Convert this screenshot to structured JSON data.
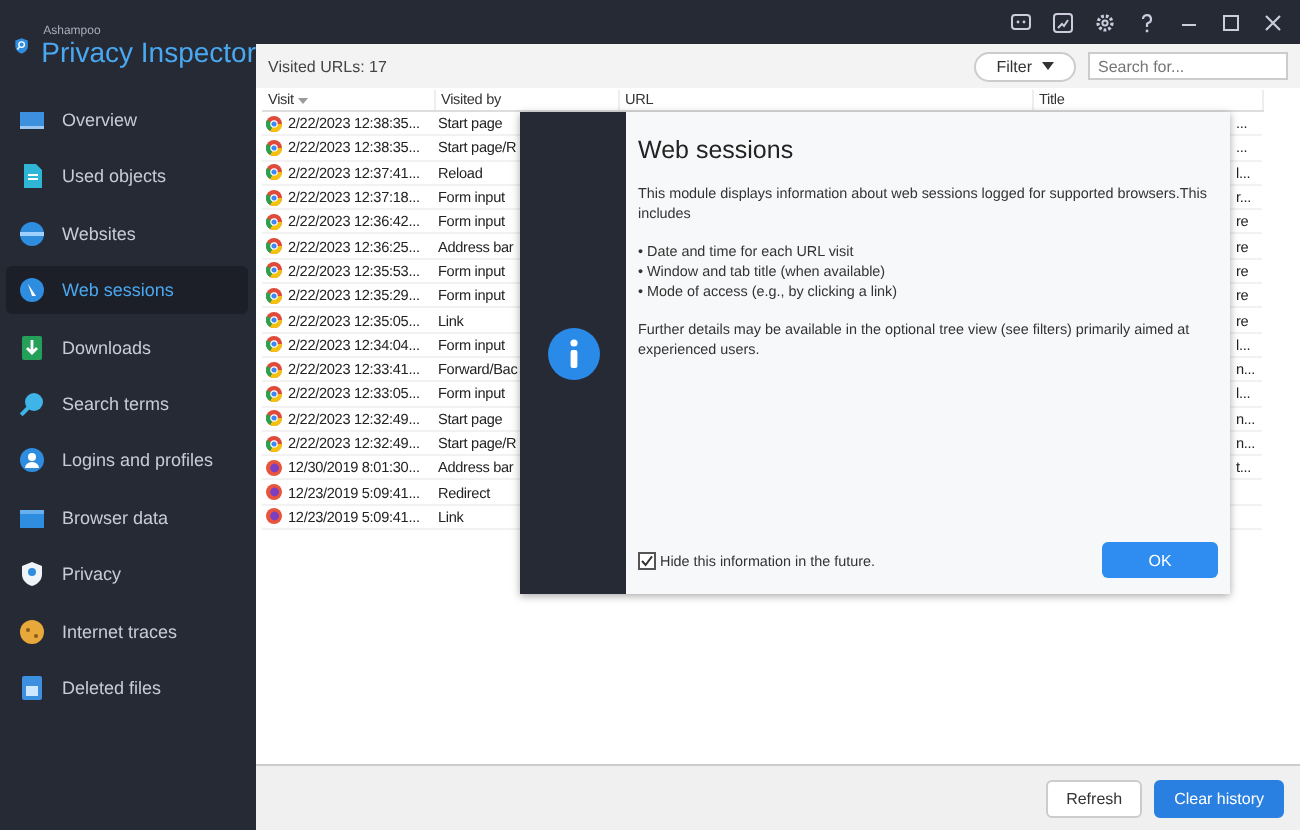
{
  "app": {
    "vendor": "Ashampoo",
    "title": "Privacy Inspector"
  },
  "sidebar": {
    "items": [
      {
        "label": "Overview",
        "selected": false
      },
      {
        "label": "Used objects",
        "selected": false
      },
      {
        "label": "Websites",
        "selected": false
      },
      {
        "label": "Web sessions",
        "selected": true
      },
      {
        "label": "Downloads",
        "selected": false
      },
      {
        "label": "Search terms",
        "selected": false
      },
      {
        "label": "Logins and profiles",
        "selected": false
      },
      {
        "label": "Browser data",
        "selected": false
      },
      {
        "label": "Privacy",
        "selected": false
      },
      {
        "label": "Internet traces",
        "selected": false
      },
      {
        "label": "Deleted files",
        "selected": false
      }
    ]
  },
  "toolbar": {
    "count": "Visited URLs: 17",
    "filter": "Filter",
    "search": {
      "placeholder": "Search for..."
    }
  },
  "table": {
    "columns": [
      "Visit",
      "Visited by",
      "URL",
      "Title"
    ],
    "rows": [
      {
        "kind": "chrome",
        "visit": "2/22/2023 12:38:35...",
        "visited_by": "Start page",
        "title": "..."
      },
      {
        "kind": "chrome",
        "visit": "2/22/2023 12:38:35...",
        "visited_by": "Start page/R",
        "title": "..."
      },
      {
        "kind": "chrome",
        "visit": "2/22/2023 12:37:41...",
        "visited_by": "Reload",
        "title": "l..."
      },
      {
        "kind": "chrome",
        "visit": "2/22/2023 12:37:18...",
        "visited_by": "Form input",
        "title": "r..."
      },
      {
        "kind": "chrome",
        "visit": "2/22/2023 12:36:42...",
        "visited_by": "Form input",
        "title": "re"
      },
      {
        "kind": "chrome",
        "visit": "2/22/2023 12:36:25...",
        "visited_by": "Address bar",
        "title": "re"
      },
      {
        "kind": "chrome",
        "visit": "2/22/2023 12:35:53...",
        "visited_by": "Form input",
        "title": "re"
      },
      {
        "kind": "chrome",
        "visit": "2/22/2023 12:35:29...",
        "visited_by": "Form input",
        "title": "re"
      },
      {
        "kind": "chrome",
        "visit": "2/22/2023 12:35:05...",
        "visited_by": "Link",
        "title": "re"
      },
      {
        "kind": "chrome",
        "visit": "2/22/2023 12:34:04...",
        "visited_by": "Form input",
        "title": "l..."
      },
      {
        "kind": "chrome",
        "visit": "2/22/2023 12:33:41...",
        "visited_by": "Forward/Bac",
        "title": "n..."
      },
      {
        "kind": "chrome",
        "visit": "2/22/2023 12:33:05...",
        "visited_by": "Form input",
        "title": "l..."
      },
      {
        "kind": "chrome",
        "visit": "2/22/2023 12:32:49...",
        "visited_by": "Start page",
        "title": "n..."
      },
      {
        "kind": "chrome",
        "visit": "2/22/2023 12:32:49...",
        "visited_by": "Start page/R",
        "title": "n..."
      },
      {
        "kind": "firefox",
        "visit": "12/30/2019 8:01:30...",
        "visited_by": "Address bar",
        "title": "t..."
      },
      {
        "kind": "firefox",
        "visit": "12/23/2019 5:09:41...",
        "visited_by": "Redirect"
      },
      {
        "kind": "firefox",
        "visit": "12/23/2019 5:09:41...",
        "visited_by": "Link"
      }
    ]
  },
  "dialog": {
    "title": "Web sessions",
    "intro": "This module displays information about web sessions logged for supported browsers.This includes",
    "bullets": [
      "• Date and time for each URL visit",
      "• Window and tab title (when available)",
      "• Mode of access (e.g., by clicking a link)"
    ],
    "details": "Further details may be available in the optional tree view (see filters) primarily aimed at experienced users.",
    "checkbox": {
      "label": "Hide this information in the future.",
      "checked": true
    },
    "ok": "OK"
  },
  "buttons": [
    {
      "label": "Refresh",
      "kind": "secondary"
    },
    {
      "label": "Clear history",
      "kind": "primary"
    }
  ]
}
